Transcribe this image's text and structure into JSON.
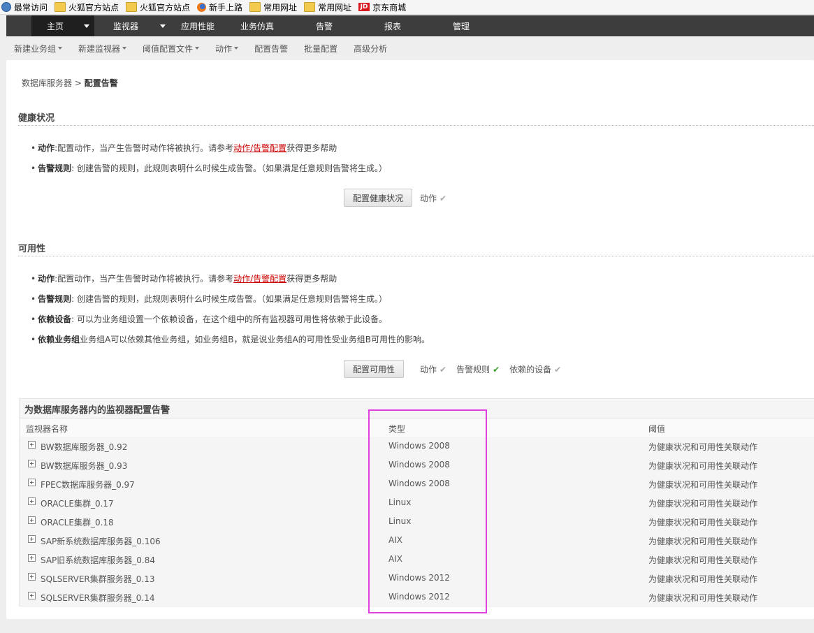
{
  "bookmarks": [
    {
      "label": "最常访问",
      "icon": "globe-icon"
    },
    {
      "label": "火狐官方站点",
      "icon": "folder-icon"
    },
    {
      "label": "火狐官方站点",
      "icon": "folder-icon"
    },
    {
      "label": "新手上路",
      "icon": "firefox-icon"
    },
    {
      "label": "常用网址",
      "icon": "folder-icon"
    },
    {
      "label": "常用网址",
      "icon": "folder-icon"
    },
    {
      "label": "京东商城",
      "icon": "jd-icon"
    }
  ],
  "mainnav": [
    "主页",
    "监视器",
    "应用性能",
    "业务仿真",
    "告警",
    "报表",
    "管理"
  ],
  "subnav": [
    "新建业务组",
    "新建监视器",
    "阈值配置文件",
    "动作",
    "配置告警",
    "批量配置",
    "高级分析"
  ],
  "breadcrumb": {
    "parent": "数据库服务器",
    "separator": " > ",
    "current": "配置告警"
  },
  "health": {
    "title": "健康状况",
    "action_label": "动作",
    "action_text": ":配置动作，当产生告警时动作将被执行。请参考",
    "action_link": "动作/告警配置",
    "action_suffix": "获得更多帮助",
    "rule_label": "告警规则",
    "rule_text": ": 创建告警的规则，此规则表明什么时候生成告警。（如果满足任意规则告警将生成。）",
    "button": "配置健康状况",
    "status_action": "动作"
  },
  "availability": {
    "title": "可用性",
    "action_label": "动作",
    "action_text": ":配置动作，当产生告警时动作将被执行。请参考",
    "action_link": "动作/告警配置",
    "action_suffix": "获得更多帮助",
    "rule_label": "告警规则",
    "rule_text": ": 创建告警的规则，此规则表明什么时候生成告警。（如果满足任意规则告警将生成。）",
    "dep_label": "依赖设备",
    "dep_text": ": 可以为业务组设置一个依赖设备，在这个组中的所有监视器可用性将依赖于此设备。",
    "depgroup_label": "依赖业务组",
    "depgroup_text": "业务组A可以依赖其他业务组，如业务组B，就是说业务组A的可用性受业务组B可用性的影响。",
    "button": "配置可用性",
    "status_action": "动作",
    "status_rule": "告警规则",
    "status_dep": "依赖的设备"
  },
  "monitors": {
    "title": "为数据库服务器内的监视器配置告警",
    "columns": [
      "监视器名称",
      "类型",
      "阈值"
    ],
    "rows": [
      {
        "name": "BW数据库服务器_0.92",
        "type": "Windows 2008",
        "threshold": "为健康状况和可用性关联动作"
      },
      {
        "name": "BW数据库服务器_0.93",
        "type": "Windows 2008",
        "threshold": "为健康状况和可用性关联动作"
      },
      {
        "name": "FPEC数据库服务器_0.97",
        "type": "Windows 2008",
        "threshold": "为健康状况和可用性关联动作"
      },
      {
        "name": "ORACLE集群_0.17",
        "type": "Linux",
        "threshold": "为健康状况和可用性关联动作"
      },
      {
        "name": "ORACLE集群_0.18",
        "type": "Linux",
        "threshold": "为健康状况和可用性关联动作"
      },
      {
        "name": "SAP新系统数据库服务器_0.106",
        "type": "AIX",
        "threshold": "为健康状况和可用性关联动作"
      },
      {
        "name": "SAP旧系统数据库服务器_0.84",
        "type": "AIX",
        "threshold": "为健康状况和可用性关联动作"
      },
      {
        "name": "SQLSERVER集群服务器_0.13",
        "type": "Windows 2012",
        "threshold": "为健康状况和可用性关联动作"
      },
      {
        "name": "SQLSERVER集群服务器_0.14",
        "type": "Windows 2012",
        "threshold": "为健康状况和可用性关联动作"
      }
    ]
  },
  "colors": {
    "highlight": "#e040e0",
    "check_green": "#3a9a2a",
    "nav_bg": "#3d3d3d",
    "link": "#cc0000"
  }
}
